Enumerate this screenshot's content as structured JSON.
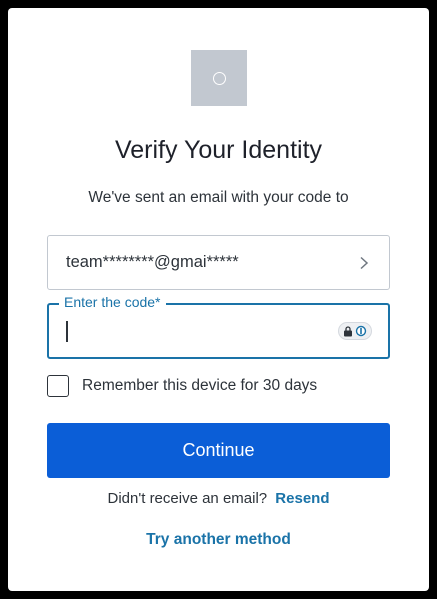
{
  "colors": {
    "accent": "#1a73a8",
    "button": "#0b5ed7",
    "logo_placeholder": "#c2c8d0"
  },
  "header": {
    "logo_icon": "circle-logo-icon",
    "title": "Verify Your Identity",
    "subtitle": "We've sent an email with your code to"
  },
  "email": {
    "value": "team********@gmai*****",
    "icon": "chevron-right-icon"
  },
  "code": {
    "label": "Enter the code*",
    "value": "",
    "placeholder": "",
    "password_manager_icon": "password-manager-icon"
  },
  "remember": {
    "label": "Remember this device for 30 days",
    "checked": false
  },
  "actions": {
    "continue_label": "Continue",
    "resend_prompt": "Didn't receive an email?",
    "resend_label": "Resend",
    "try_another_label": "Try another method"
  }
}
